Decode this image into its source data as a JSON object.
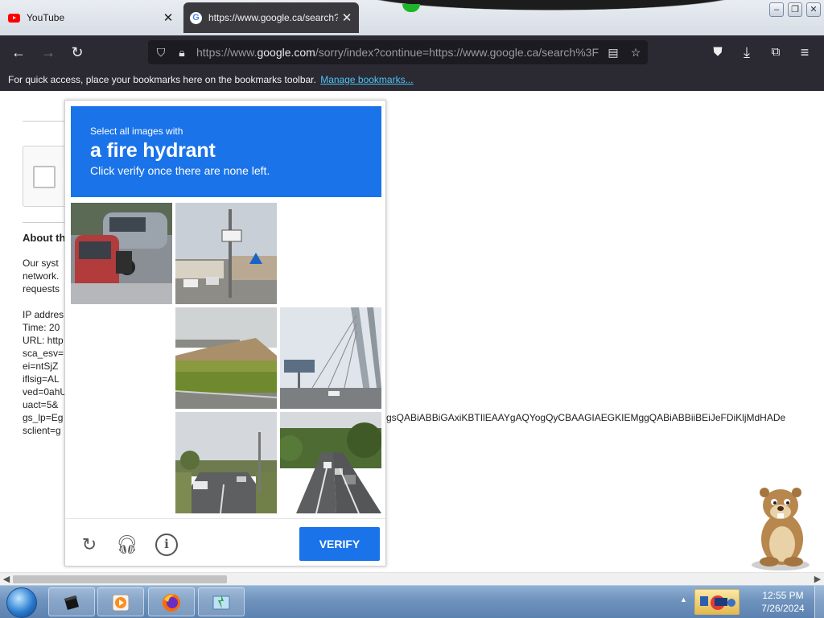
{
  "browser": {
    "tabs": [
      {
        "title": "YouTube",
        "icon": "youtube-icon",
        "active": false
      },
      {
        "title": "https://www.google.ca/search?q=",
        "icon": "google-icon",
        "active": true
      }
    ],
    "url": {
      "prefix": "https://www.",
      "host": "google.com",
      "rest": "/sorry/index?continue=https://www.google.ca/search%3F"
    },
    "bookmarks_bar": {
      "text": "For quick access, place your bookmarks here on the bookmarks toolbar.",
      "link": "Manage bookmarks..."
    }
  },
  "page": {
    "about_title": "About th",
    "body_lines": [
      "Our syst",
      "network.",
      "requests"
    ],
    "meta_lines": [
      "IP addres",
      "Time: 20",
      "URL: http",
      "sca_esv=",
      "ei=ntSjZ",
      "iflsig=AL",
      "ved=0ahU",
      "uact=5&",
      "gs_lp=Eg",
      "sclient=g"
    ],
    "gs_tail": "gsQABiABBiGAxiKBTIlEAAYgAQYogQyCBAAGIAEGKIEMggQABiABBiiBEiJeFDiKljMdHADe"
  },
  "captcha": {
    "header_small": "Select all images with",
    "header_target": "a fire hydrant",
    "header_hint": "Click verify once there are none left.",
    "verify_label": "VERIFY",
    "tiles": [
      {
        "desc": "parked cars and motorcycle",
        "filled": true
      },
      {
        "desc": "street with utility pole",
        "filled": true
      },
      {
        "desc": "blank",
        "filled": false
      },
      {
        "desc": "blank",
        "filled": false
      },
      {
        "desc": "overpass with grass",
        "filled": true
      },
      {
        "desc": "cable-stayed bridge",
        "filled": true
      },
      {
        "desc": "blank",
        "filled": false
      },
      {
        "desc": "road with street lamp",
        "filled": true
      },
      {
        "desc": "tree-lined road with traffic",
        "filled": true
      }
    ]
  },
  "taskbar": {
    "clock_time": "12:55 PM",
    "clock_date": "7/26/2024"
  },
  "colors": {
    "accent": "#1a73e8",
    "browser_chrome": "#2b2a33",
    "link": "#4fc3f7"
  }
}
